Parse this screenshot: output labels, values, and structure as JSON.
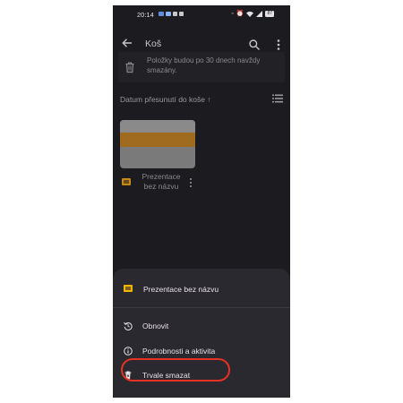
{
  "status_bar": {
    "time": "20:14",
    "battery": "87",
    "icons": [
      "notification-icons",
      "mute-icon",
      "alarm-icon",
      "wifi-icon",
      "signal-icon",
      "battery-icon"
    ]
  },
  "app_bar": {
    "title": "Koš",
    "back_icon": "arrow-back-icon",
    "search_icon": "search-icon",
    "more_icon": "more-vert-icon"
  },
  "banner": {
    "text": "Položky budou po 30 dnech navždy smazány.",
    "icon": "trash-icon"
  },
  "sort": {
    "label": "Datum přesunutí do koše ↑",
    "view_icon": "list-view-icon"
  },
  "files": [
    {
      "name": "Prezentace bez názvu",
      "type_icon": "slides-icon"
    }
  ],
  "bottom_sheet": {
    "title": "Prezentace bez názvu",
    "items": [
      {
        "label": "Obnovit",
        "icon": "restore-icon"
      },
      {
        "label": "Podrobnosti a aktivita",
        "icon": "info-icon"
      },
      {
        "label": "Trvale smazat",
        "icon": "delete-forever-icon"
      }
    ]
  },
  "colors": {
    "background": "#1c1b1f",
    "sheet": "#2b2930",
    "slides_yellow": "#f4b400",
    "highlight": "#e53224"
  }
}
